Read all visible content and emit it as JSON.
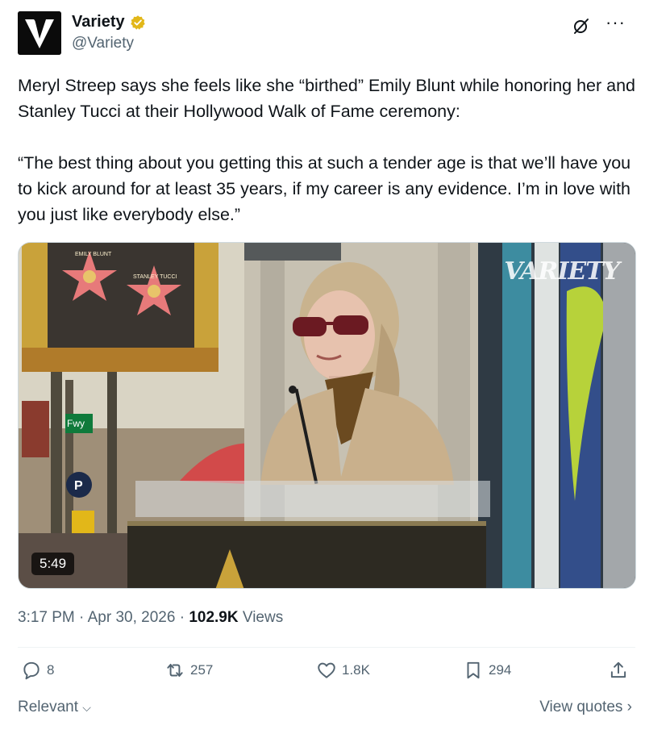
{
  "author": {
    "name": "Variety",
    "handle": "@Variety",
    "avatar_icon": "variety-v-logo",
    "verified_color": "#e2b719"
  },
  "tweet": {
    "paragraphs": [
      "Meryl Streep says she feels like she “birthed” Emily Blunt while honoring her and Stanley Tucci at their Hollywood Walk of Fame ceremony:",
      "“The best thing about you getting this at such a tender age is that we’ll have you to kick around for at least 35 years, if my career is any evidence. I’m in love with you just like everybody else.”"
    ]
  },
  "media": {
    "duration": "5:49",
    "watermark": "VARIETY",
    "sign_text": "Fwy",
    "star_names": [
      "EMILY BLUNT",
      "STANLEY TUCCI"
    ],
    "parking_letter": "P"
  },
  "meta": {
    "time": "3:17 PM",
    "separator": "·",
    "date": "Apr 30, 2026",
    "views_count": "102.9K",
    "views_label": "Views"
  },
  "actions": {
    "replies": "8",
    "reposts": "257",
    "likes": "1.8K",
    "bookmarks": "294"
  },
  "footer": {
    "sort_label": "Relevant",
    "view_quotes": "View quotes"
  },
  "colors": {
    "text": "#0f1419",
    "secondary": "#536471",
    "divider": "#eff3f4"
  }
}
